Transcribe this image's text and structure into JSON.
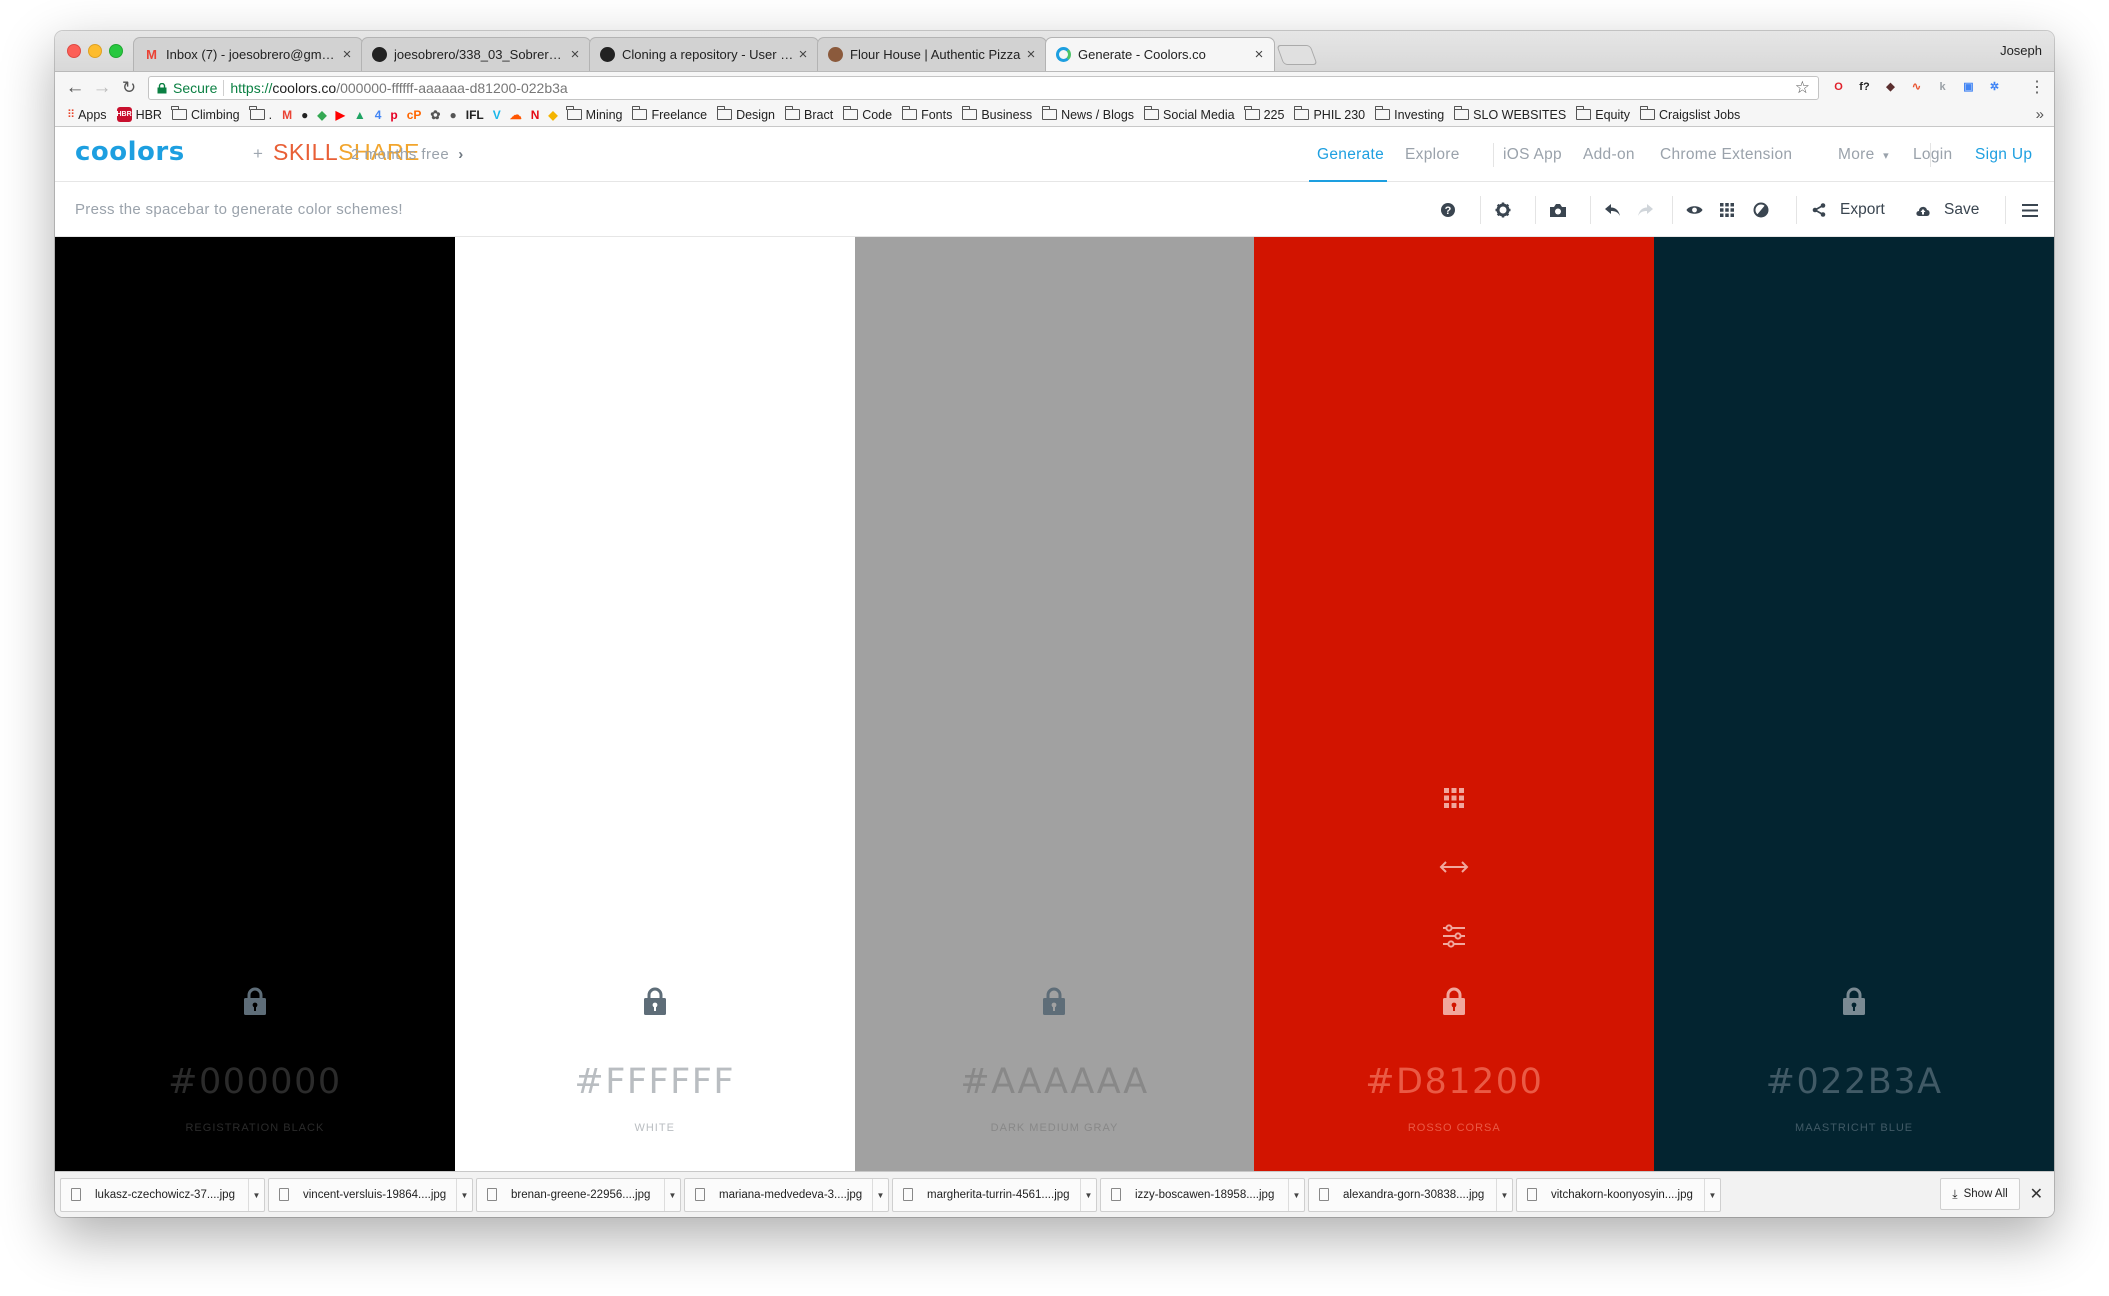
{
  "browser": {
    "tabs": [
      {
        "title": "Inbox (7) - joesobrero@gmail.c",
        "icon": "gmail-icon",
        "color": "#ea4335"
      },
      {
        "title": "joesobrero/338_03_Sobrero_fi",
        "icon": "github-icon",
        "color": "#222222"
      },
      {
        "title": "Cloning a repository - User Do",
        "icon": "github-icon",
        "color": "#222222"
      },
      {
        "title": "Flour House | Authentic Pizza",
        "icon": "flourhouse-icon",
        "color": "#8b5a3c"
      },
      {
        "title": "Generate - Coolors.co",
        "icon": "coolors-icon",
        "color": "#1d9fe0"
      }
    ],
    "profile": "Joseph",
    "secure_label": "Secure",
    "url_scheme": "https://",
    "url_host": "coolors.co",
    "url_path": "/000000-ffffff-aaaaaa-d81200-022b3a",
    "bookmarks": [
      {
        "label": "Apps",
        "type": "apps"
      },
      {
        "label": "HBR",
        "type": "icon",
        "color": "#c8102e"
      },
      {
        "label": "Climbing",
        "type": "folder"
      },
      {
        "label": ".",
        "type": "folder"
      },
      {
        "label": "Mining",
        "type": "folder"
      },
      {
        "label": "Freelance",
        "type": "folder"
      },
      {
        "label": "Design",
        "type": "folder"
      },
      {
        "label": "Bract",
        "type": "folder"
      },
      {
        "label": "Code",
        "type": "folder"
      },
      {
        "label": "Fonts",
        "type": "folder"
      },
      {
        "label": "Business",
        "type": "folder"
      },
      {
        "label": "News / Blogs",
        "type": "folder"
      },
      {
        "label": "Social Media",
        "type": "folder"
      },
      {
        "label": "225",
        "type": "folder"
      },
      {
        "label": "PHIL 230",
        "type": "folder"
      },
      {
        "label": "Investing",
        "type": "folder"
      },
      {
        "label": "SLO WEBSITES",
        "type": "folder"
      },
      {
        "label": "Equity",
        "type": "folder"
      },
      {
        "label": "Craigslist Jobs",
        "type": "folder"
      }
    ],
    "bookmark_icons": [
      {
        "name": "gmail-icon",
        "glyph": "M",
        "color": "#ea4335"
      },
      {
        "name": "github-icon",
        "glyph": "●",
        "color": "#222222"
      },
      {
        "name": "maps-icon",
        "glyph": "◆",
        "color": "#34a853"
      },
      {
        "name": "youtube-icon",
        "glyph": "▶",
        "color": "#ff0000"
      },
      {
        "name": "drive-icon",
        "glyph": "▲",
        "color": "#1fa463"
      },
      {
        "name": "calendar-icon",
        "glyph": "4",
        "color": "#4285f4"
      },
      {
        "name": "pinterest-icon",
        "glyph": "p",
        "color": "#e60023"
      },
      {
        "name": "cp-icon",
        "glyph": "cP",
        "color": "#ff6600"
      },
      {
        "name": "leaf-icon",
        "glyph": "✿",
        "color": "#555555"
      },
      {
        "name": "apple-icon",
        "glyph": "●",
        "color": "#555555"
      },
      {
        "name": "ifl-icon",
        "glyph": "IFL",
        "color": "#222222"
      },
      {
        "name": "vimeo-icon",
        "glyph": "V",
        "color": "#1ab7ea"
      },
      {
        "name": "soundcloud-icon",
        "glyph": "☁",
        "color": "#ff5500"
      },
      {
        "name": "netflix-icon",
        "glyph": "N",
        "color": "#e50914"
      },
      {
        "name": "shield-icon",
        "glyph": "◆",
        "color": "#f4b400"
      }
    ],
    "extension_icons": [
      {
        "name": "opera-icon",
        "glyph": "O",
        "color": "#e0202b"
      },
      {
        "name": "font-icon",
        "glyph": "f?",
        "color": "#222222"
      },
      {
        "name": "spy-icon",
        "glyph": "◆",
        "color": "#5b2f2f"
      },
      {
        "name": "signal-icon",
        "glyph": "∿",
        "color": "#e8522e"
      },
      {
        "name": "ext-grey-icon",
        "glyph": "k",
        "color": "#9aa0a6"
      },
      {
        "name": "window-icon",
        "glyph": "▣",
        "color": "#4285f4"
      },
      {
        "name": "gear-blue-icon",
        "glyph": "✲",
        "color": "#3b82f6"
      }
    ]
  },
  "site": {
    "logo": "coolors",
    "partner_plus": "+",
    "partner_a": "SKILL",
    "partner_b": "SHARE",
    "promo": "2 months free",
    "nav": {
      "generate": "Generate",
      "explore": "Explore",
      "ios_app": "iOS App",
      "addon": "Add-on",
      "chrome_ext": "Chrome Extension",
      "more": "More",
      "login": "Login",
      "signup": "Sign Up"
    },
    "hint": "Press the spacebar to generate color schemes!",
    "toolbar": {
      "export": "Export",
      "save": "Save"
    }
  },
  "palette": [
    {
      "hex": "#000000",
      "name": "REGISTRATION BLACK",
      "bg": "#000000",
      "text": "#2b2b2b",
      "lock": "#5e6d78"
    },
    {
      "hex": "#FFFFFF",
      "name": "WHITE",
      "bg": "#ffffff",
      "text": "#b9bdc1",
      "lock": "#5e6d78"
    },
    {
      "hex": "#AAAAAA",
      "name": "DARK MEDIUM GRAY",
      "bg": "#a1a1a1",
      "text": "#888888",
      "lock": "#5e6d78"
    },
    {
      "hex": "#D81200",
      "name": "ROSSO CORSA",
      "bg": "#d21400",
      "text": "#ea5a45",
      "lock": "#f1a79d"
    },
    {
      "hex": "#022B3A",
      "name": "MAASTRICHT BLUE",
      "bg": "#032430",
      "text": "#415a66",
      "lock": "#7a8a93"
    }
  ],
  "downloads": [
    "lukasz-czechowicz-37....jpg",
    "vincent-versluis-19864....jpg",
    "brenan-greene-22956....jpg",
    "mariana-medvedeva-3....jpg",
    "margherita-turrin-4561....jpg",
    "izzy-boscawen-18958....jpg",
    "alexandra-gorn-30838....jpg",
    "vitchakorn-koonyosyin....jpg"
  ],
  "show_all": "Show All"
}
